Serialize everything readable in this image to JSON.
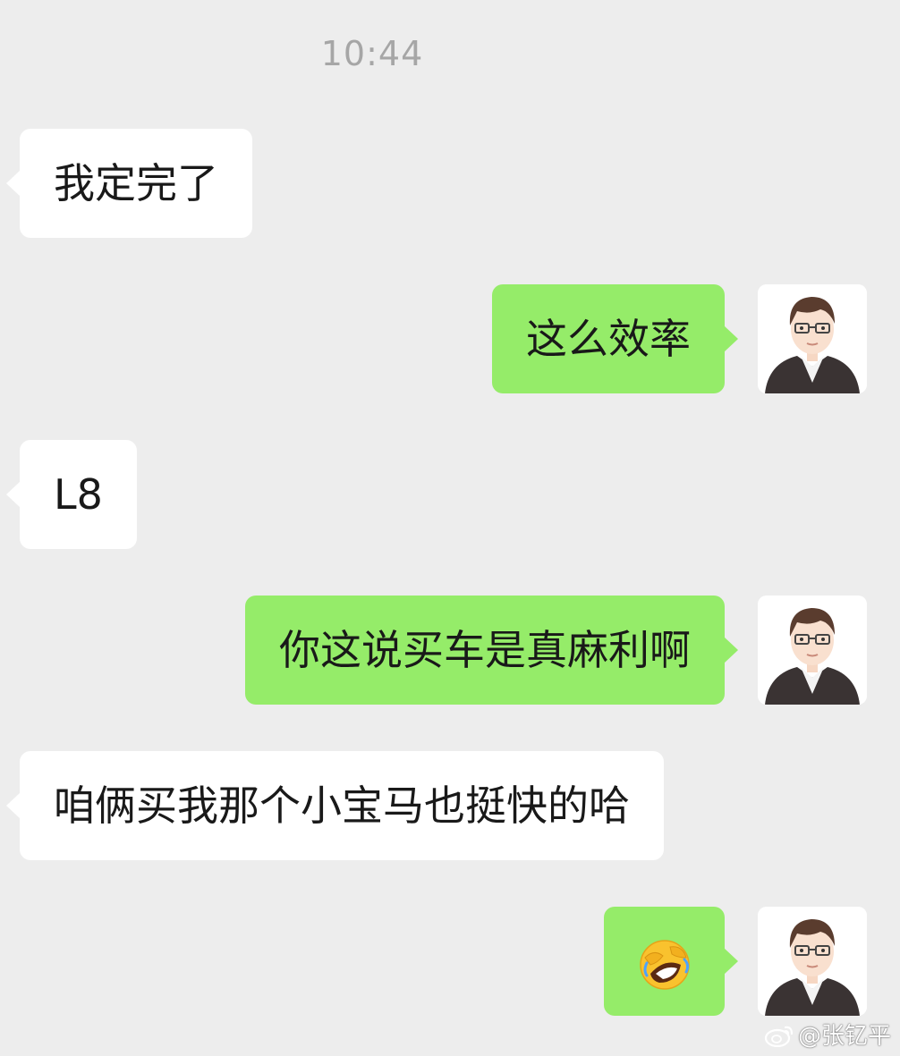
{
  "chat": {
    "timestamp": "10:44",
    "messages": [
      {
        "side": "in",
        "text": "我定完了"
      },
      {
        "side": "out",
        "text": "这么效率"
      },
      {
        "side": "in",
        "text": "L8"
      },
      {
        "side": "out",
        "text": "你这说买车是真麻利啊"
      },
      {
        "side": "in",
        "text": "咱俩买我那个小宝马也挺快的哈"
      },
      {
        "side": "out",
        "text": "",
        "emoji": "rolling-on-floor-laughing-emoji"
      }
    ]
  },
  "colors": {
    "background": "#ededed",
    "incoming_bubble": "#ffffff",
    "outgoing_bubble": "#95ec69",
    "timestamp_text": "#a6a6a6"
  },
  "watermark": {
    "text": "@张钇平",
    "icon": "weibo-logo"
  }
}
